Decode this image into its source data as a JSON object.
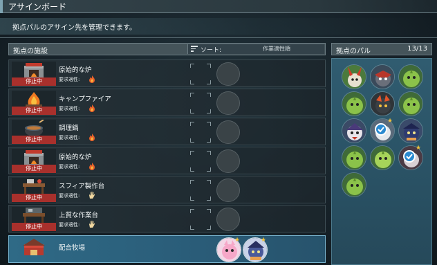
{
  "header": {
    "title": "アサインボード"
  },
  "description": "拠点パルのアサイン先を管理できます。",
  "facility_panel": {
    "title": "拠点の施設",
    "sort_label": "ソート:",
    "sort_value": "作業適性順"
  },
  "pal_panel": {
    "title": "拠点のパル",
    "count": "13/13"
  },
  "facilities": [
    {
      "name": "原始的な炉",
      "req_label": "要求適性:",
      "status": "停止中",
      "req_icon": "fire-icon",
      "icon": "furnace-icon"
    },
    {
      "name": "キャンプファイア",
      "req_label": "要求適性:",
      "status": "停止中",
      "req_icon": "fire-icon",
      "icon": "campfire-icon"
    },
    {
      "name": "調理鍋",
      "req_label": "要求適性:",
      "status": "停止中",
      "req_icon": "fire-icon",
      "icon": "cooking-pot-icon"
    },
    {
      "name": "原始的な炉",
      "req_label": "要求適性:",
      "status": "停止中",
      "req_icon": "fire-icon",
      "icon": "furnace-icon"
    },
    {
      "name": "スフィア製作台",
      "req_label": "要求適性:",
      "status": "停止中",
      "req_icon": "hand-icon",
      "icon": "workbench-icon"
    },
    {
      "name": "上質な作業台",
      "req_label": "要求適性:",
      "status": "停止中",
      "req_icon": "hand-icon",
      "icon": "workbench-icon"
    },
    {
      "name": "配合牧場",
      "req_label": "",
      "status": "",
      "req_icon": "",
      "icon": "breeding-farm-icon"
    }
  ],
  "colors": {
    "accent": "#2f6a86",
    "stopped_badge": "#a8302c",
    "check_badge": "#2a8ad0",
    "fire": "#e8612a",
    "hand": "#f0d7a0"
  }
}
